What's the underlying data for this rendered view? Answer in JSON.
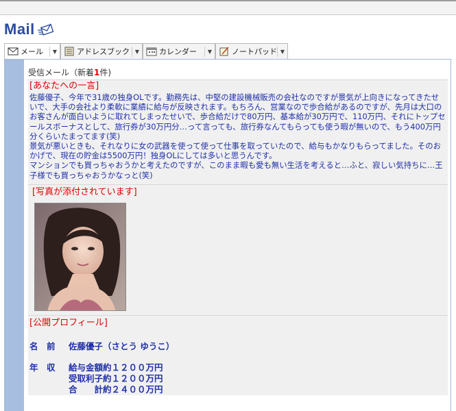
{
  "app": {
    "title": "Mail"
  },
  "tabs": [
    {
      "label": "メール",
      "icon": "mail-icon",
      "active": true
    },
    {
      "label": "アドレスブック",
      "icon": "address-book-icon",
      "active": false
    },
    {
      "label": "カレンダー",
      "icon": "calendar-icon",
      "active": false
    },
    {
      "label": "ノートパッド",
      "icon": "notepad-icon",
      "active": false
    }
  ],
  "inbox": {
    "prefix": "受信メール（新着",
    "count": "1",
    "suffix": "件)"
  },
  "message": {
    "section_title": "[あなたへの一言]",
    "paragraphs": [
      "佐藤優子、今年で31歳の独身OLです。勤務先は、中堅の建設機械販売の会社なのですが景気が上向きになってきたせいで、大手の会社より柔軟に業績に給与が反映されます。もちろん、営業なので歩合給があるのですが、先月は大口のお客さんが面白いように取れてしまったせいで、歩合給だけで80万円、基本給が30万円で、110万円、それにトップセールスボーナスとして、旅行券が30万円分…って言っても、旅行券なんてもらっても使う暇が無いので、もう400万円分くらいたまってます(笑)",
      "景気が悪いときも、それなりに女の武器を使って使って仕事を取っていたので、給与もかなりもらってました。そのおかげで、現在の貯金は5500万円！独身OLにしては多いと思うんです。",
      "マンションでも買っちゃおうかと考えたのですが、このまま暇も愛も無い生活を考えると…ふと、寂しい気持ちに…王子様でも買っちゃおうかなっと(笑)"
    ]
  },
  "photo": {
    "section_title": "[写真が添付されています]"
  },
  "profile": {
    "section_title": "[公開プロフィール]",
    "name_label": "名　前",
    "name_value": "佐藤優子（さとう ゆうこ）",
    "income_label": "年　収",
    "income_lines": [
      "給与金額約１２００万円",
      "受取利子約１２００万円",
      "合　　計約２４００万円"
    ]
  }
}
